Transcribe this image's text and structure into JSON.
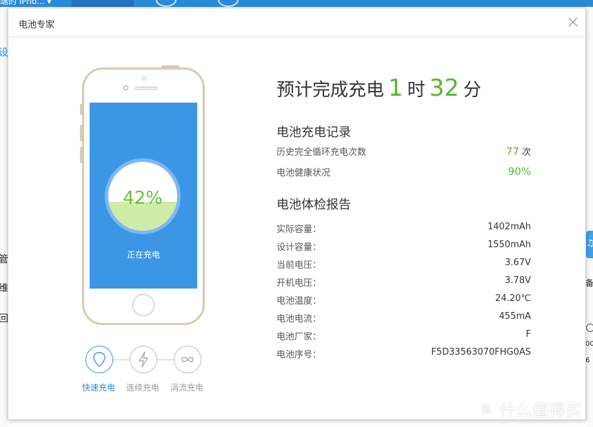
{
  "background": {
    "device_label": "端的 iPho... ▾",
    "left_labels": [
      "设",
      "管",
      "维",
      "回"
    ],
    "right_labels": [
      "备",
      "00",
      "6"
    ]
  },
  "watermark": {
    "text": "什么值得买",
    "glyph": "值"
  },
  "dialog": {
    "title": "电池专家",
    "close_icon": "close-icon"
  },
  "phone": {
    "battery_percent": "42%",
    "battery_level": 0.42,
    "status": "正在充电"
  },
  "modes": [
    {
      "label": "快速充电",
      "icon": "shield-icon",
      "glyph": "◯",
      "active": true
    },
    {
      "label": "连续充电",
      "icon": "lightning-icon",
      "glyph": "ϟ",
      "active": false
    },
    {
      "label": "涓流充电",
      "icon": "infinity-icon",
      "glyph": "∞",
      "active": false
    }
  ],
  "eta": {
    "prefix": "预计完成充电",
    "hours": "1",
    "hours_unit": "时",
    "minutes": "32",
    "minutes_unit": "分"
  },
  "charge_record": {
    "title": "电池充电记录",
    "cycles_label": "历史完全循环充电次数",
    "cycles_value": "77",
    "cycles_unit": "次",
    "health_label": "电池健康状况",
    "health_value": "90%"
  },
  "report": {
    "title": "电池体检报告",
    "rows": [
      {
        "label": "实际容量：",
        "value": "1402mAh"
      },
      {
        "label": "设计容量：",
        "value": "1550mAh"
      },
      {
        "label": "当前电压：",
        "value": "3.67V"
      },
      {
        "label": "开机电压：",
        "value": "3.78V"
      },
      {
        "label": "电池温度：",
        "value": "24.20℃"
      },
      {
        "label": "电池电流：",
        "value": "455mA"
      },
      {
        "label": "电池厂家：",
        "value": "F"
      },
      {
        "label": "电池序号：",
        "value": "F5D33563070FHG0AS"
      }
    ]
  },
  "colors": {
    "accent_blue": "#2a8ad7",
    "screen_blue": "#3b97e5",
    "green": "#5bb333",
    "battery_fill": "#cdeca7",
    "phone_gold": "#dcc8ae"
  }
}
